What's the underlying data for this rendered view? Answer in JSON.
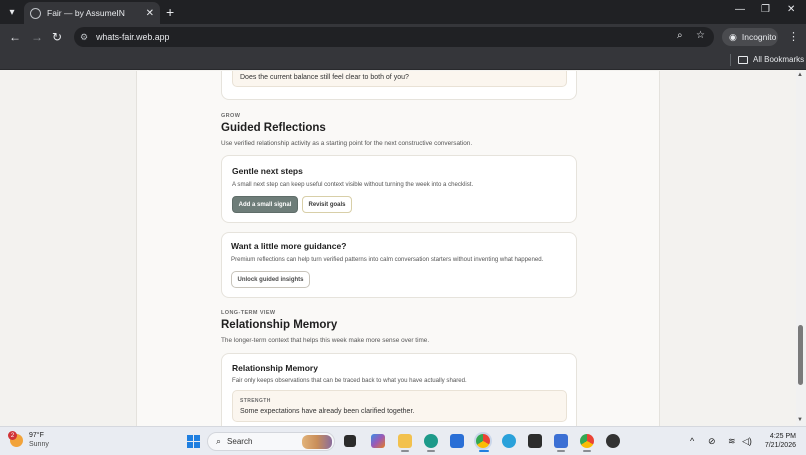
{
  "browser": {
    "tab_title": "Fair — by AssumeIN",
    "url": "whats-fair.web.app",
    "incognito_label": "Incognito",
    "bookmarks_label": "All Bookmarks",
    "icons": [
      "tab-list-icon",
      "globe-icon",
      "close-icon",
      "plus-icon",
      "back-icon",
      "forward-icon",
      "reload-icon",
      "site-settings-icon",
      "zoom-icon",
      "star-icon",
      "incognito-icon",
      "kebab-icon",
      "folder-icon"
    ]
  },
  "page": {
    "top_quote": "Does the current balance still feel clear to both of you?",
    "grow": {
      "eyebrow": "GROW",
      "title": "Guided Reflections",
      "subtitle": "Use verified relationship activity as a starting point for the next constructive conversation."
    },
    "next_steps": {
      "title": "Gentle next steps",
      "body": "A small next step can keep useful context visible without turning the week into a checklist.",
      "primary_button": "Add a small signal",
      "secondary_button": "Revisit goals"
    },
    "guidance": {
      "title": "Want a little more guidance?",
      "body": "Premium reflections can help turn verified patterns into calm conversation starters without inventing what happened.",
      "button": "Unlock guided insights"
    },
    "long_term": {
      "eyebrow": "LONG-TERM VIEW",
      "title": "Relationship Memory",
      "subtitle": "The longer-term context that helps this week make more sense over time."
    },
    "memory_card": {
      "title": "Relationship Memory",
      "body": "Fair only keeps observations that can be traced back to what you have actually shared.",
      "strength_label": "STRENGTH",
      "strength_text": "Some expectations have already been clarified together."
    }
  },
  "taskbar": {
    "weather_temp": "97°F",
    "weather_cond": "Sunny",
    "weather_badge": "2",
    "search_placeholder": "Search",
    "time": "4:25 PM",
    "date": "7/21/2026",
    "accent": "#1f7fe0"
  }
}
